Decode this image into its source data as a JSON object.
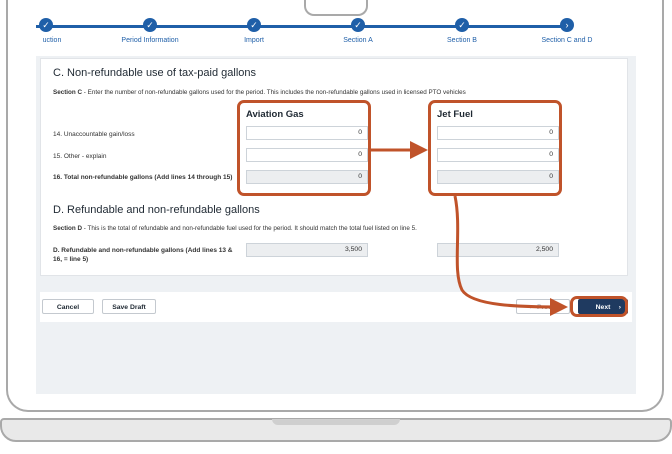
{
  "stepper": {
    "steps": [
      {
        "label": "uction",
        "state": "done"
      },
      {
        "label": "Period Information",
        "state": "done"
      },
      {
        "label": "Import",
        "state": "done"
      },
      {
        "label": "Section A",
        "state": "done"
      },
      {
        "label": "Section B",
        "state": "done"
      },
      {
        "label": "Section C and D",
        "state": "current"
      }
    ],
    "check_glyph": "✓",
    "current_glyph": "›"
  },
  "section_c": {
    "title": "C. Non-refundable use of tax-paid gallons",
    "desc_lead": "Section C",
    "desc_text": " - Enter the number of non-refundable gallons used for the period. This includes the non-refundable gallons used in licensed PTO vehicles",
    "columns": [
      "Aviation Gas",
      "Jet Fuel"
    ],
    "rows": [
      {
        "label": "14. Unaccountable gain/loss",
        "aviation": "0",
        "jet": "0"
      },
      {
        "label": "15. Other - explain",
        "aviation": "0",
        "jet": "0"
      },
      {
        "label": "16. Total non-refundable gallons (Add lines 14 through 15)",
        "aviation": "0",
        "jet": "0"
      }
    ]
  },
  "section_d": {
    "title": "D. Refundable and non-refundable gallons",
    "desc_lead": "Section D",
    "desc_text": " - This is the total of refundable and non-refundable fuel used for the period. It should match the total fuel listed on line 5.",
    "row_label": "D. Refundable and non-refundable gallons (Add lines 13 & 16, = line 5)",
    "aviation": "3,500",
    "jet": "2,500"
  },
  "footer": {
    "cancel": "Cancel",
    "save_draft": "Save Draft",
    "previous_partial": "← Previo",
    "next": "Next",
    "next_chevron": "›"
  },
  "colors": {
    "accent": "#1f5fa8",
    "annotation": "#c0532a",
    "primary_button": "#1f3a60"
  }
}
